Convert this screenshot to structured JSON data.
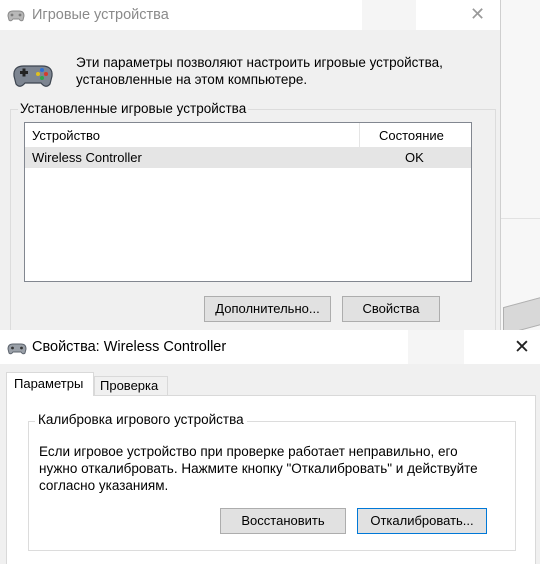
{
  "window_main": {
    "title": "Игровые устройства",
    "close_glyph": "✕",
    "description": "Эти параметры позволяют настроить игровые устройства, установленные на этом компьютере.",
    "group_label": "Установленные игровые устройства",
    "list": {
      "columns": [
        "Устройство",
        "Состояние"
      ],
      "rows": [
        {
          "device": "Wireless Controller",
          "status": "OK"
        }
      ]
    },
    "buttons": {
      "advanced": "Дополнительно...",
      "properties": "Свойства"
    }
  },
  "window_props": {
    "title": "Свойства: Wireless Controller",
    "close_glyph": "✕",
    "tabs": [
      "Параметры",
      "Проверка"
    ],
    "group_label": "Калибровка игрового устройства",
    "description": "Если игровое устройство при проверке работает неправильно, его нужно откалибровать. Нажмите кнопку \"Откалибровать\" и действуйте согласно указаниям.",
    "buttons": {
      "restore": "Восстановить",
      "calibrate": "Откалибровать..."
    }
  },
  "icons": {
    "title_icon": "gamepad-icon",
    "device_icon": "gamepad-icon"
  }
}
